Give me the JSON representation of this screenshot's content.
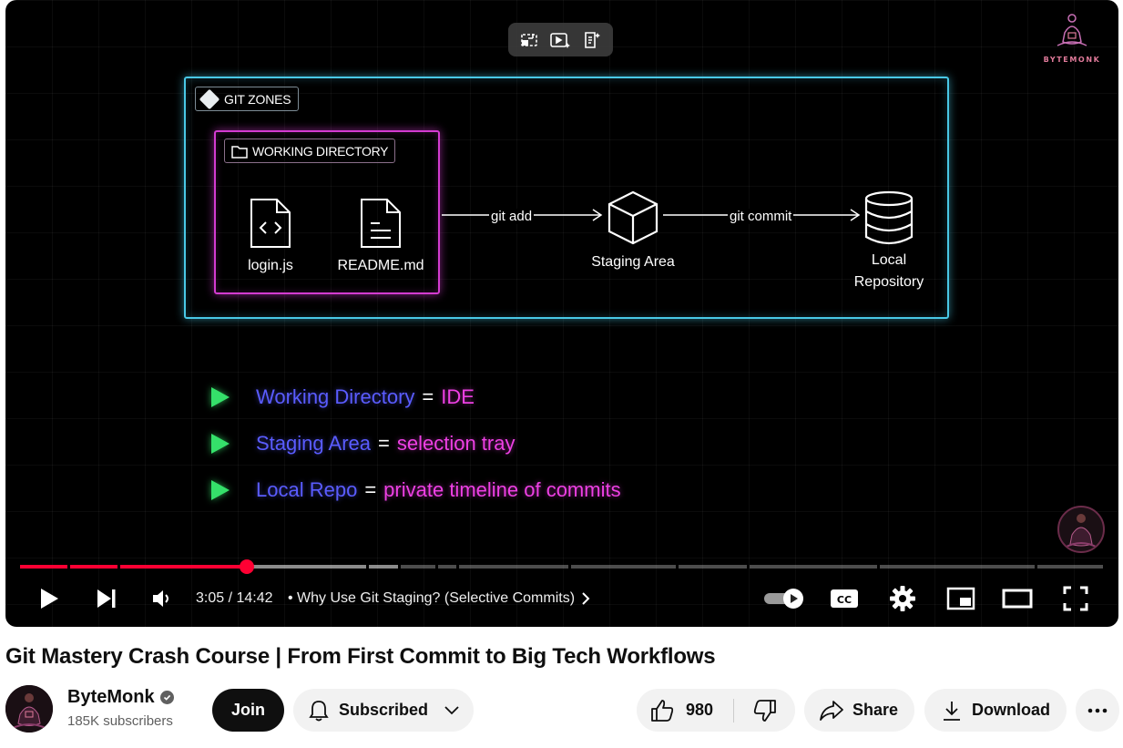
{
  "video": {
    "diagram": {
      "zones_label": "GIT ZONES",
      "workdir_label": "WORKING DIRECTORY",
      "files": [
        "login.js",
        "README.md"
      ],
      "arrow1": "git add",
      "arrow2": "git commit",
      "staging": "Staging Area",
      "repo_line1": "Local",
      "repo_line2": "Repository"
    },
    "brand": "BYTEMONK",
    "bullets": [
      {
        "key": "Working Directory",
        "eq": "=",
        "val": "IDE"
      },
      {
        "key": "Staging Area",
        "eq": "=",
        "val": "selection tray"
      },
      {
        "key": "Local Repo",
        "eq": "=",
        "val": "private timeline of commits"
      }
    ],
    "progress": {
      "played_fraction": 0.213,
      "buffered_fraction": 0.35
    },
    "time": "3:05 / 14:42",
    "chapter": "•  Why Use Git Staging? (Selective Commits)"
  },
  "title": "Git Mastery Crash Course | From First Commit to Big Tech Workflows",
  "channel": {
    "name": "ByteMonk",
    "subscribers": "185K subscribers"
  },
  "actions": {
    "join": "Join",
    "subscribed": "Subscribed",
    "likes": "980",
    "share": "Share",
    "download": "Download"
  },
  "colors": {
    "accent": "#ff0033",
    "cyan": "#49c8e6",
    "magenta": "#d33bd0",
    "green": "#35e06a"
  }
}
